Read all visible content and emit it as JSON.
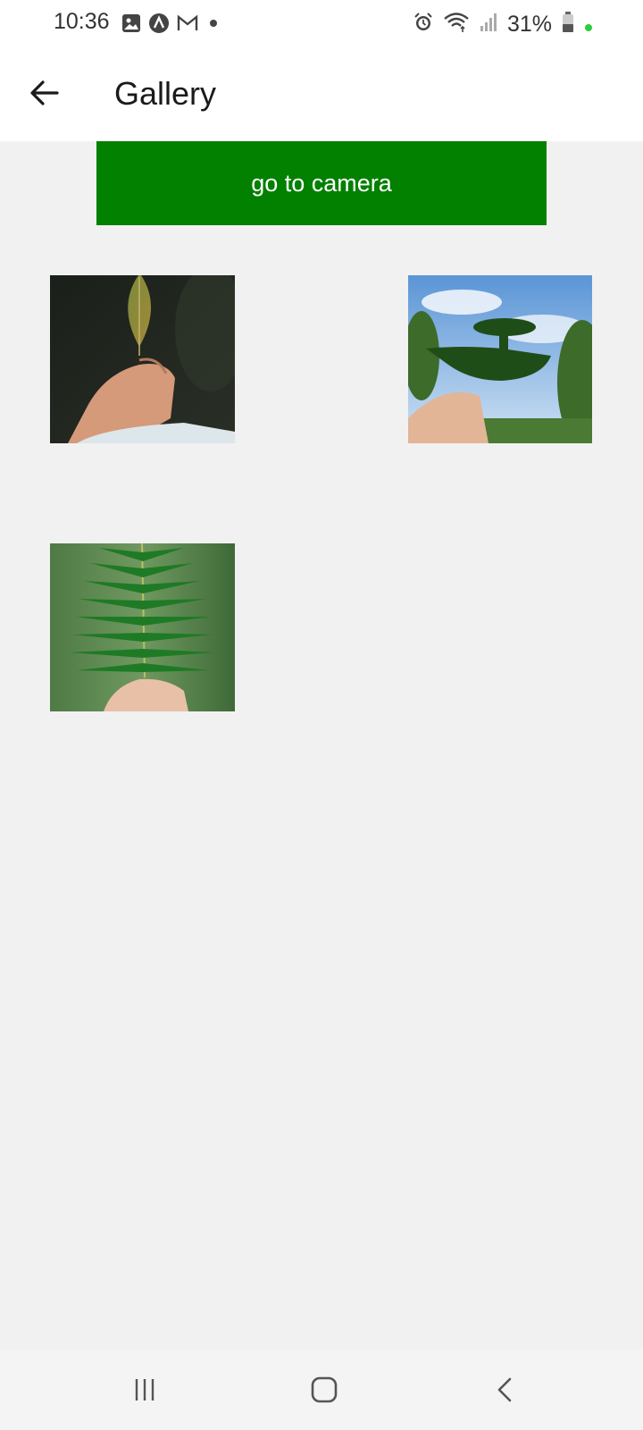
{
  "status_bar": {
    "time": "10:36",
    "battery_percent": "31%",
    "left_icons": [
      "image-icon",
      "app-icon",
      "gmail-icon",
      "dot-icon"
    ],
    "right_icons": [
      "alarm-icon",
      "wifi-icon",
      "signal-icon",
      "battery-icon"
    ]
  },
  "app_bar": {
    "title": "Gallery",
    "back_icon": "arrow-left-icon"
  },
  "camera_button": {
    "label": "go to camera",
    "color": "#028000"
  },
  "gallery": {
    "images": [
      {
        "name": "leaf-in-hand-photo"
      },
      {
        "name": "leaf-art-boat-photo"
      },
      {
        "name": "fern-leaf-photo"
      }
    ]
  },
  "nav_bar": {
    "buttons": [
      "recent-apps-icon",
      "home-icon",
      "back-icon"
    ]
  }
}
